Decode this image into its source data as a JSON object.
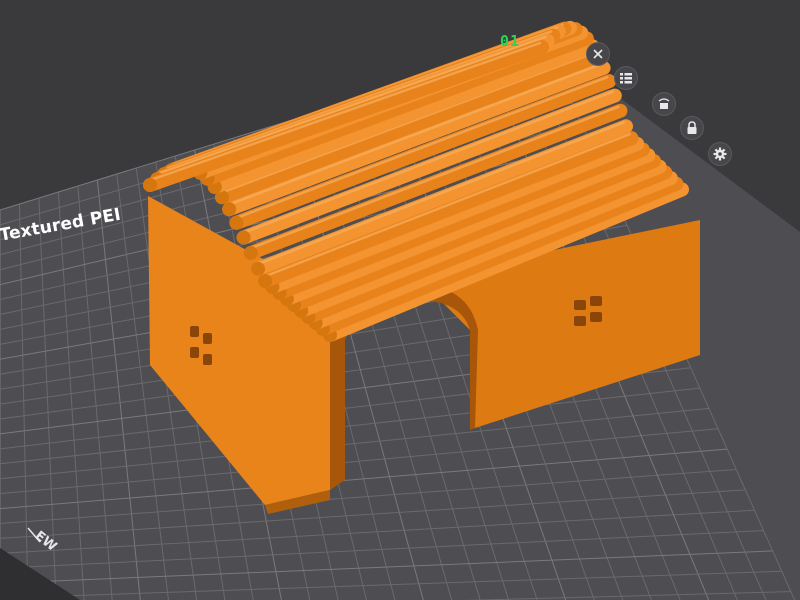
{
  "viewport": {
    "plate_label": "Textured PEI",
    "plate_number": "01",
    "corner_mark": "EW"
  },
  "colors": {
    "background": "#3a3a3c",
    "plate": "#4e4e52",
    "grid": "#6a6a6e",
    "model": "#f08a1c",
    "plate_number": "#2fd05a"
  },
  "plate_toolbar": [
    {
      "name": "close",
      "icon": "close-icon"
    },
    {
      "name": "arrange",
      "icon": "arrange-icon"
    },
    {
      "name": "auto-orient",
      "icon": "auto-orient-icon"
    },
    {
      "name": "lock",
      "icon": "lock-icon"
    },
    {
      "name": "settings",
      "icon": "gear-icon"
    }
  ]
}
